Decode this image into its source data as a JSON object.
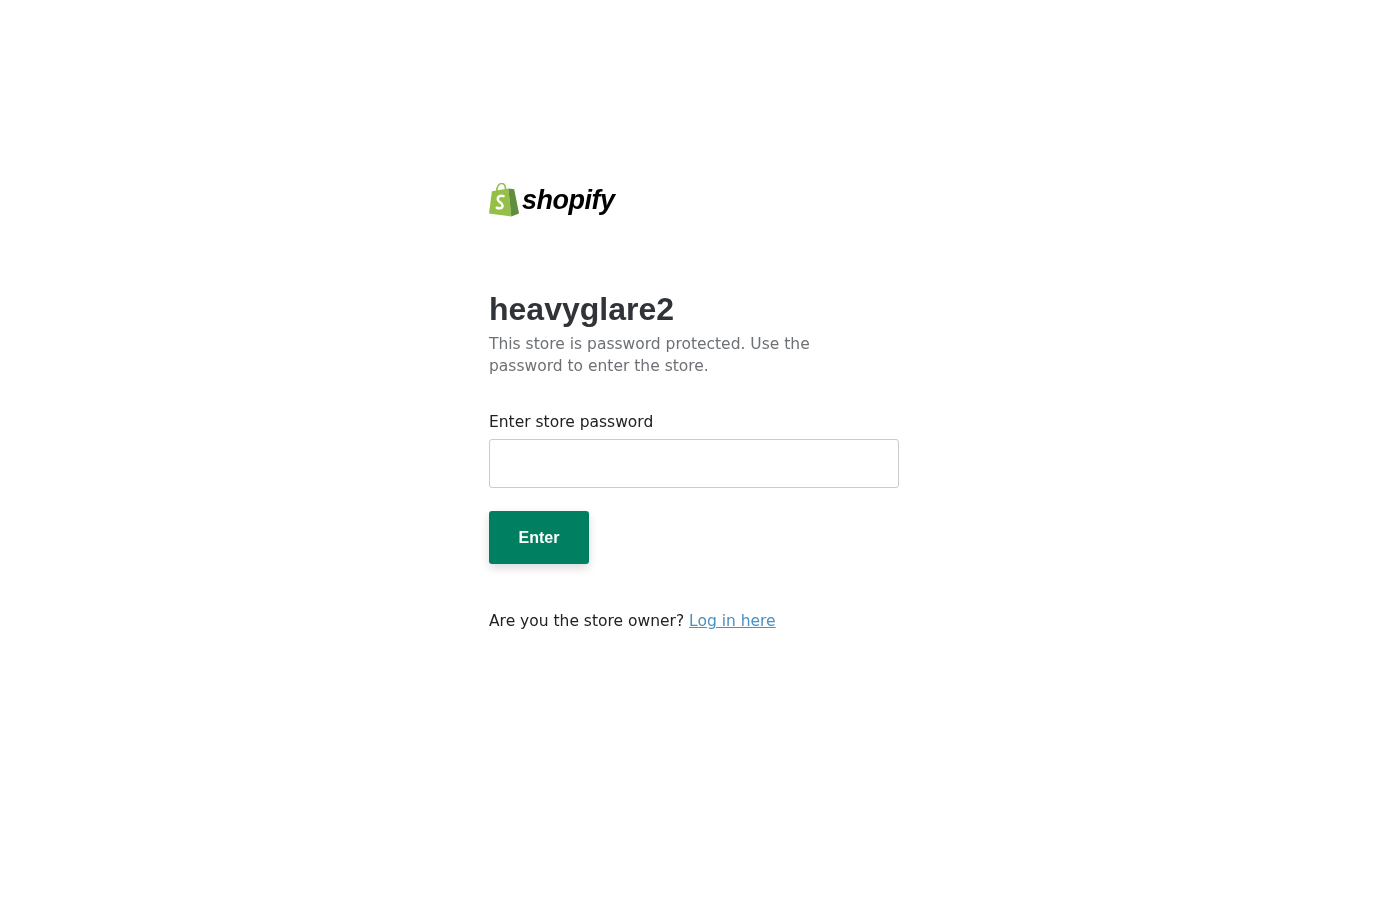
{
  "logo": {
    "wordmark": "shopify"
  },
  "store": {
    "name": "heavyglare2",
    "description": "This store is password protected. Use the password to enter the store."
  },
  "password_form": {
    "label": "Enter store password",
    "button": "Enter"
  },
  "owner_prompt": {
    "text": "Are you the store owner?",
    "link": "Log in here"
  }
}
